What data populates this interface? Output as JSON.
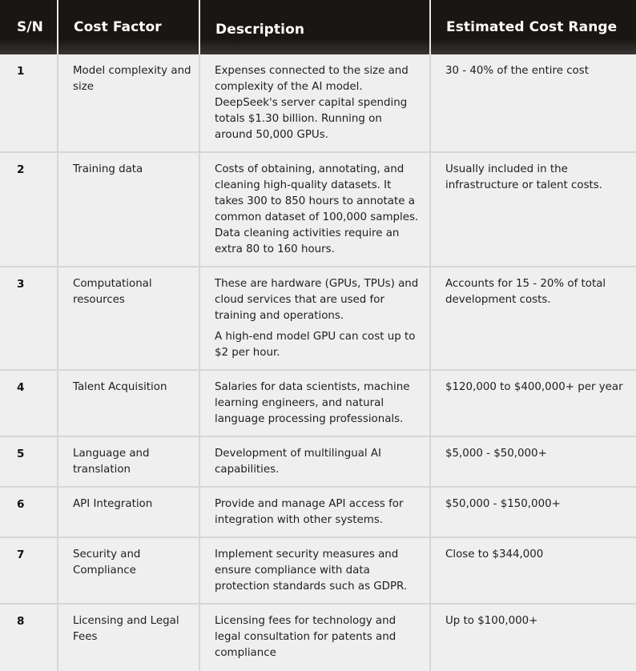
{
  "table": {
    "headers": {
      "sn": "S/N",
      "cost_factor": "Cost Factor",
      "description": "Description",
      "estimated_cost_range": "Estimated Cost Range"
    },
    "rows": [
      {
        "sn": "1",
        "cost_factor": "Model complexity and size",
        "description": "Expenses connected to the size and complexity of the AI model. DeepSeek's server capital spending totals $1.30 billion. Running on around 50,000 GPUs.",
        "description_extra": "",
        "estimated_cost_range": "30 - 40% of the entire cost"
      },
      {
        "sn": "2",
        "cost_factor": "Training data",
        "description": "Costs of obtaining, annotating, and cleaning high-quality datasets. It takes 300 to 850 hours to annotate a common dataset of 100,000 samples. Data cleaning activities require an extra 80 to 160 hours.",
        "description_extra": "",
        "estimated_cost_range": "Usually included in the infrastructure or talent costs."
      },
      {
        "sn": "3",
        "cost_factor": "Computational resources",
        "description": "These are hardware (GPUs, TPUs) and cloud services that are used for training and operations.",
        "description_extra": "A high-end model GPU can cost up to $2 per hour.",
        "estimated_cost_range": "Accounts for 15 - 20% of total development costs."
      },
      {
        "sn": "4",
        "cost_factor": "Talent Acquisition",
        "description": "Salaries for data scientists, machine learning engineers, and natural language processing professionals.",
        "description_extra": "",
        "estimated_cost_range": "$120,000 to $400,000+ per year"
      },
      {
        "sn": "5",
        "cost_factor": "Language and translation",
        "description": "Development of multilingual AI capabilities.",
        "description_extra": "",
        "estimated_cost_range": "$5,000 - $50,000+"
      },
      {
        "sn": "6",
        "cost_factor": "API Integration",
        "description": "Provide and manage API access for integration with other systems.",
        "description_extra": "",
        "estimated_cost_range": "$50,000 - $150,000+"
      },
      {
        "sn": "7",
        "cost_factor": "Security and Compliance",
        "description": "Implement security measures and ensure compliance with data protection standards such as GDPR.",
        "description_extra": "",
        "estimated_cost_range": "Close to $344,000"
      },
      {
        "sn": "8",
        "cost_factor": "Licensing and Legal Fees",
        "description": "Licensing fees for technology and legal consultation for patents and compliance",
        "description_extra": "",
        "estimated_cost_range": "Up to $100,000+"
      }
    ]
  },
  "colors": {
    "header_bg": "#1a1613",
    "header_text": "#ffffff",
    "row_bg": "#efefef",
    "grid_line": "#d6d6d6",
    "body_text": "#1e1e1e"
  }
}
